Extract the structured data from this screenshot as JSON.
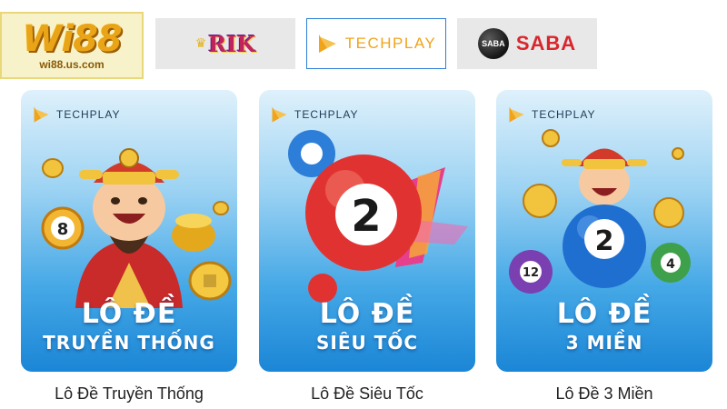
{
  "brand": {
    "logo_text": "Wi88",
    "logo_url_text": "wi88.us.com"
  },
  "providers": [
    {
      "id": "rik",
      "label": "RIK",
      "icon": "rikvip-logo-icon",
      "selected": false
    },
    {
      "id": "techplay",
      "label": "TECHPLAY",
      "icon": "techplay-logo-icon",
      "selected": true
    },
    {
      "id": "saba",
      "label": "SABA",
      "badge": "SABA",
      "icon": "saba-ball-icon",
      "selected": false
    }
  ],
  "games": [
    {
      "brand": "TECHPLAY",
      "title": "LÔ ĐỀ",
      "subtitle": "TRUYỀN THỐNG",
      "caption": "Lô Đề Truyền Thống",
      "art": "god-of-wealth-icon",
      "ball_number": "8"
    },
    {
      "brand": "TECHPLAY",
      "title": "LÔ ĐỀ",
      "subtitle": "SIÊU TỐC",
      "caption": "Lô Đề Siêu Tốc",
      "art": "lottery-ball-icon",
      "ball_number": "2"
    },
    {
      "brand": "TECHPLAY",
      "title": "LÔ ĐỀ",
      "subtitle": "3 MIỀN",
      "caption": "Lô Đề 3 Miền",
      "art": "god-of-wealth-balls-icon",
      "ball_number": "2",
      "side_balls": [
        "12",
        "4"
      ]
    }
  ],
  "colors": {
    "accent": "#2e7fd4",
    "techplay_orange": "#f0a41a",
    "saba_red": "#d9262c",
    "logo_gold": "#e9a417"
  }
}
